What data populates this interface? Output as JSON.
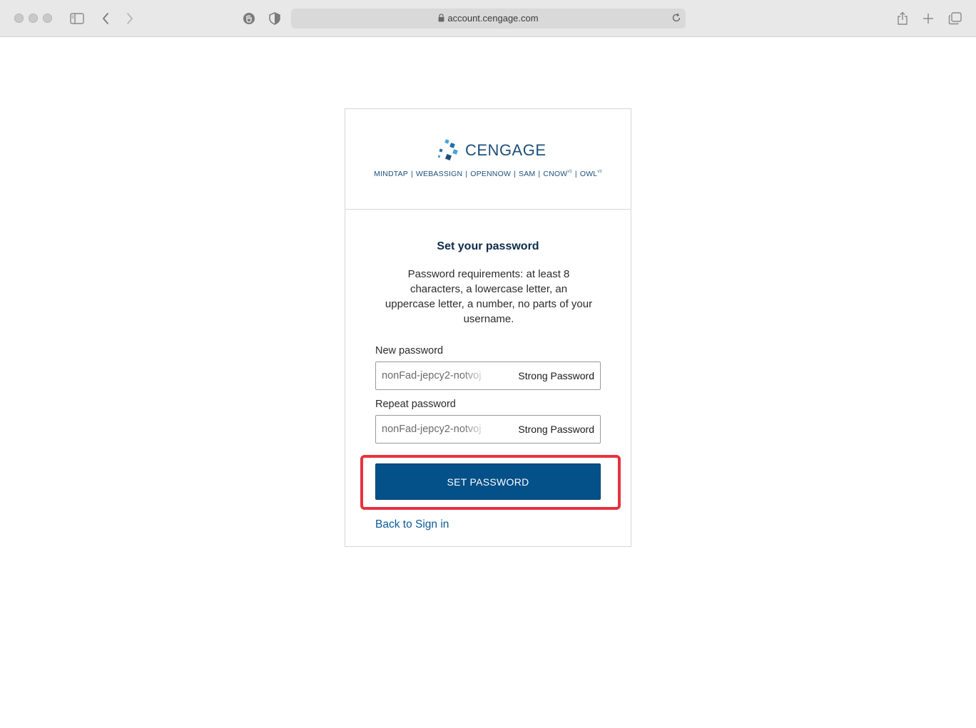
{
  "browser": {
    "url": "account.cengage.com"
  },
  "brand": {
    "name": "CENGAGE",
    "colors": {
      "primary": "#1d4f7c",
      "button": "#045089",
      "link": "#0a5a96",
      "highlight": "#e8323f"
    },
    "products": [
      {
        "label": "MINDTAP",
        "sup": ""
      },
      {
        "label": "WEBASSIGN",
        "sup": ""
      },
      {
        "label": "OPENNOW",
        "sup": ""
      },
      {
        "label": "SAM",
        "sup": ""
      },
      {
        "label": "CNOW",
        "sup": "V2"
      },
      {
        "label": "OWL",
        "sup": "V2"
      }
    ]
  },
  "form": {
    "title": "Set your password",
    "requirements": "Password requirements: at least 8 characters, a lowercase letter, an uppercase letter, a number, no parts of your username.",
    "new_password": {
      "label": "New password",
      "value": "nonFad-jepcy2-notvoj",
      "badge": "Strong Password"
    },
    "repeat_password": {
      "label": "Repeat password",
      "value": "nonFad-jepcy2-notvoj",
      "badge": "Strong Password"
    },
    "submit_label": "SET PASSWORD",
    "back_link": "Back to Sign in"
  }
}
